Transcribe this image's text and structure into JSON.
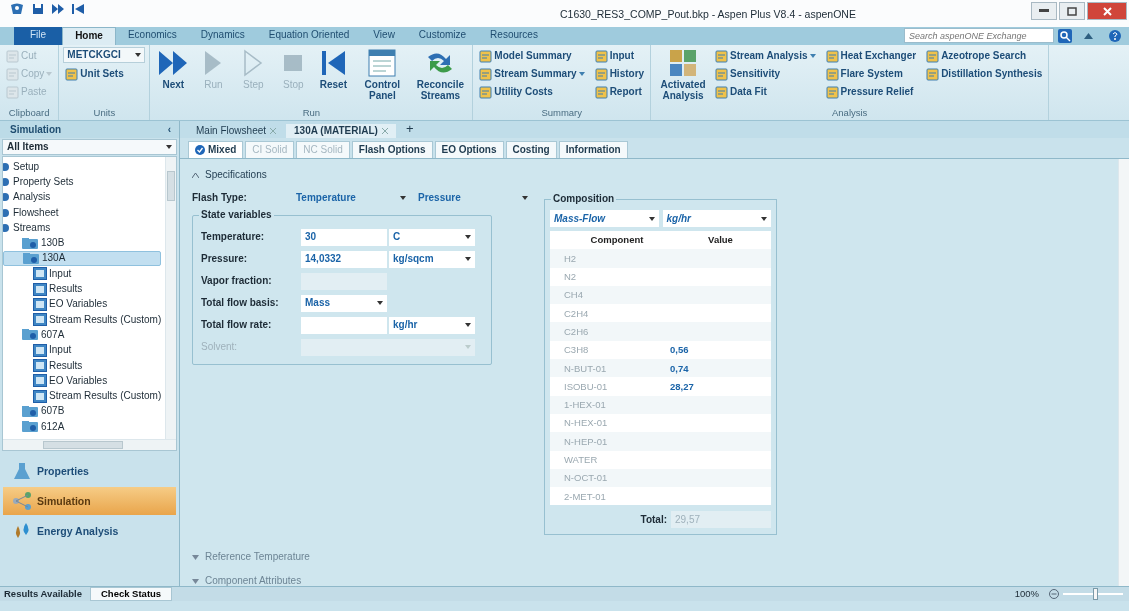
{
  "window": {
    "title": "C1630_RES3_COMP_Pout.bkp - Aspen Plus V8.4 - aspenONE"
  },
  "ribbon_tabs": [
    {
      "label": "File",
      "kind": "file",
      "selected": false
    },
    {
      "label": "Home",
      "kind": "tab",
      "selected": true
    },
    {
      "label": "Economics",
      "kind": "tab",
      "selected": false
    },
    {
      "label": "Dynamics",
      "kind": "tab",
      "selected": false
    },
    {
      "label": "Equation Oriented",
      "kind": "tab",
      "selected": false
    },
    {
      "label": "View",
      "kind": "tab",
      "selected": false
    },
    {
      "label": "Customize",
      "kind": "tab",
      "selected": false
    },
    {
      "label": "Resources",
      "kind": "tab",
      "selected": false
    }
  ],
  "search": {
    "placeholder": "Search aspenONE Exchange"
  },
  "ribbon_groups": [
    {
      "label": "Clipboard",
      "items": [
        {
          "label": "Cut",
          "kind": "small",
          "disabled": true
        },
        {
          "label": "Copy",
          "kind": "small",
          "disabled": true,
          "menu": true
        },
        {
          "label": "Paste",
          "kind": "small",
          "disabled": true
        }
      ]
    },
    {
      "label": "Units",
      "items": [
        {
          "label": "METCKGCI",
          "kind": "dropdown"
        },
        {
          "label": "Unit Sets",
          "kind": "small",
          "disabled": false
        }
      ]
    },
    {
      "label": "Run",
      "items": [
        {
          "label": "Next",
          "kind": "big",
          "disabled": false
        },
        {
          "label": "Run",
          "kind": "big",
          "disabled": true
        },
        {
          "label": "Step",
          "kind": "big",
          "disabled": true
        },
        {
          "label": "Stop",
          "kind": "big",
          "disabled": true
        },
        {
          "label": "Reset",
          "kind": "big",
          "disabled": false
        },
        {
          "label": "Control Panel",
          "kind": "big",
          "disabled": false
        },
        {
          "label": "Reconcile Streams",
          "kind": "big",
          "disabled": false
        }
      ]
    },
    {
      "label": "Summary",
      "items": [
        {
          "label": "Model Summary",
          "kind": "small",
          "disabled": false
        },
        {
          "label": "Stream Summary",
          "kind": "small",
          "disabled": false,
          "menu": true
        },
        {
          "label": "Utility Costs",
          "kind": "small",
          "disabled": false
        },
        {
          "label": "Input",
          "kind": "small",
          "disabled": false
        },
        {
          "label": "History",
          "kind": "small",
          "disabled": false
        },
        {
          "label": "Report",
          "kind": "small",
          "disabled": false
        }
      ]
    },
    {
      "label": "Analysis",
      "items": [
        {
          "label": "Activated Analysis",
          "kind": "big",
          "disabled": false
        },
        {
          "label": "Stream Analysis",
          "kind": "small",
          "disabled": false,
          "menu": true
        },
        {
          "label": "Sensitivity",
          "kind": "small",
          "disabled": false
        },
        {
          "label": "Data Fit",
          "kind": "small",
          "disabled": false
        },
        {
          "label": "Heat Exchanger",
          "kind": "small",
          "disabled": false
        },
        {
          "label": "Flare System",
          "kind": "small",
          "disabled": false
        },
        {
          "label": "Pressure Relief",
          "kind": "small",
          "disabled": false
        },
        {
          "label": "Azeotrope Search",
          "kind": "small",
          "disabled": false
        },
        {
          "label": "Distillation Synthesis",
          "kind": "small",
          "disabled": false
        }
      ]
    }
  ],
  "sidebar": {
    "title": "Simulation",
    "collapse": "‹",
    "filter": "All Items",
    "tree": [
      {
        "label": "Setup",
        "selected": false
      },
      {
        "label": "Property Sets",
        "selected": false
      },
      {
        "label": "Analysis",
        "selected": false
      },
      {
        "label": "Flowsheet",
        "selected": false
      },
      {
        "label": "Streams",
        "selected": false,
        "children": [
          {
            "label": "130B",
            "selected": false
          },
          {
            "label": "130A",
            "selected": true,
            "children": [
              {
                "label": "Input",
                "selected": false
              },
              {
                "label": "Results",
                "selected": false
              },
              {
                "label": "EO Variables",
                "selected": false
              },
              {
                "label": "Stream Results (Custom)",
                "selected": false
              }
            ]
          },
          {
            "label": "607A",
            "selected": false,
            "children": [
              {
                "label": "Input",
                "selected": false
              },
              {
                "label": "Results",
                "selected": false
              },
              {
                "label": "EO Variables",
                "selected": false
              },
              {
                "label": "Stream Results (Custom)",
                "selected": false
              }
            ]
          },
          {
            "label": "607B",
            "selected": false
          },
          {
            "label": "612A",
            "selected": false
          }
        ]
      }
    ],
    "nav": [
      {
        "label": "Properties",
        "selected": false
      },
      {
        "label": "Simulation",
        "selected": true
      },
      {
        "label": "Energy Analysis",
        "selected": false
      }
    ]
  },
  "doc_tabs": [
    {
      "label": "Main Flowsheet",
      "selected": false
    },
    {
      "label": "130A (MATERIAL)",
      "selected": true
    }
  ],
  "add_tab": "+",
  "sub_tabs": [
    {
      "label": "Mixed",
      "selected": true,
      "disabled": false
    },
    {
      "label": "CI Solid",
      "selected": false,
      "disabled": true
    },
    {
      "label": "NC Solid",
      "selected": false,
      "disabled": true
    },
    {
      "label": "Flash Options",
      "selected": false,
      "disabled": false
    },
    {
      "label": "EO Options",
      "selected": false,
      "disabled": false
    },
    {
      "label": "Costing",
      "selected": false,
      "disabled": false
    },
    {
      "label": "Information",
      "selected": false,
      "disabled": false
    }
  ],
  "specifications": {
    "label": "Specifications",
    "expanded": true,
    "flash_type": {
      "label": "Flash Type:",
      "values": [
        "Temperature",
        "Pressure"
      ]
    },
    "state_variables": {
      "title": "State variables",
      "rows": [
        {
          "label": "Temperature:",
          "kind": "value_unit",
          "value": "30",
          "unit": "C",
          "disabled": false
        },
        {
          "label": "Pressure:",
          "kind": "value_unit",
          "value": "14,0332",
          "unit": "kg/sqcm",
          "disabled": false
        },
        {
          "label": "Vapor fraction:",
          "kind": "value",
          "disabled": false
        },
        {
          "label": "Total flow basis:",
          "kind": "select",
          "value": "Mass",
          "disabled": false
        },
        {
          "label": "Total flow rate:",
          "kind": "value_unit",
          "unit": "kg/hr",
          "disabled": false
        },
        {
          "label": "Solvent:",
          "kind": "wide",
          "disabled": true
        }
      ]
    },
    "composition": {
      "title": "Composition",
      "basis": "Mass-Flow",
      "units": "kg/hr",
      "columns": [
        "Component",
        "Value"
      ],
      "rows": [
        {
          "component": "H2"
        },
        {
          "component": "N2"
        },
        {
          "component": "CH4"
        },
        {
          "component": "C2H4"
        },
        {
          "component": "C2H6"
        },
        {
          "component": "C3H8",
          "value": "0,56"
        },
        {
          "component": "N-BUT-01",
          "value": "0,74"
        },
        {
          "component": "ISOBU-01",
          "value": "28,27"
        },
        {
          "component": "1-HEX-01"
        },
        {
          "component": "N-HEX-01"
        },
        {
          "component": "N-HEP-01"
        },
        {
          "component": "WATER"
        },
        {
          "component": "N-OCT-01"
        },
        {
          "component": "2-MET-01"
        }
      ],
      "total_label": "Total:",
      "total": "29,57"
    }
  },
  "sections": [
    {
      "label": "Reference Temperature",
      "expanded": false
    },
    {
      "label": "Component Attributes",
      "expanded": false
    }
  ],
  "status_bar": {
    "message": "Results Available",
    "check_status": "Check Status",
    "zoom": "100%",
    "zoom_slider": {
      "level": 0.55
    }
  }
}
